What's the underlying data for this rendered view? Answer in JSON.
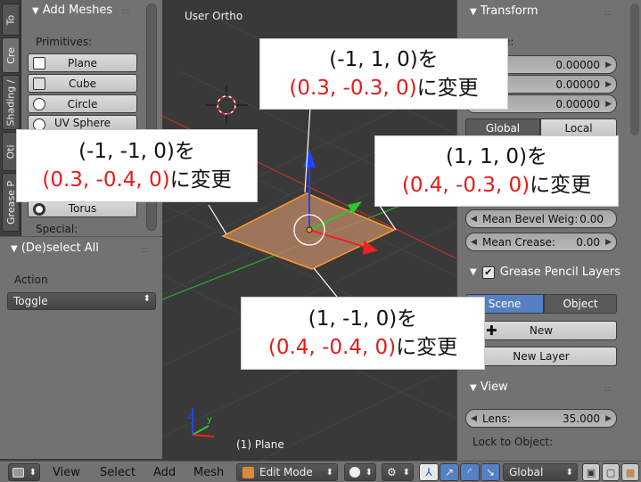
{
  "tabs": [
    "To",
    "Cre",
    "Shading /",
    "Oti",
    "Grease P"
  ],
  "shelf": {
    "title": "Add Meshes",
    "primitives_label": "Primitives:",
    "buttons": [
      "Plane",
      "Cube",
      "Circle",
      "UV Sphere",
      "Torus"
    ],
    "special_label": "Special:"
  },
  "operator": {
    "title": "(De)select All",
    "action_label": "Action",
    "action_value": "Toggle"
  },
  "viewport": {
    "view_label": "User Ortho",
    "object_label": "(1) Plane",
    "colors": {
      "selection": "#ffa033",
      "x_axis": "#e22",
      "y_axis": "#2ec82e",
      "z_axis": "#2244ff"
    }
  },
  "callouts": {
    "top": {
      "line1": "(-1, 1, 0)を",
      "red": "(0.3, -0.3, 0)",
      "suffix": "に変更"
    },
    "left": {
      "line1": "(-1, -1, 0)を",
      "red": "(0.3, -0.4, 0)",
      "suffix": "に変更"
    },
    "right": {
      "line1": "(1, 1, 0)を",
      "red": "(0.4, -0.3, 0)",
      "suffix": "に変更"
    },
    "bottom": {
      "line1": "(1, -1, 0)を",
      "red": "(0.4, -0.4, 0)",
      "suffix": "に変更"
    }
  },
  "props": {
    "transform_title": "Transform",
    "partial_label": "e:",
    "values": [
      "0.00000",
      "0.00000",
      "0.00000"
    ],
    "global_label": "Global",
    "local_label": "Local",
    "mean_bevel_label": "Mean Bevel Weig:",
    "mean_bevel_value": "0.00",
    "mean_crease_label": "Mean Crease:",
    "mean_crease_value": "0.00",
    "grease_title": "Grease Pencil Layers",
    "scene_label": "Scene",
    "object_label": "Object",
    "new_label": "New",
    "new_layer_label": "New Layer",
    "view_title": "View",
    "lens_label": "Lens:",
    "lens_value": "35.000",
    "lock_label": "Lock to Object:"
  },
  "footer": {
    "menus": [
      "View",
      "Select",
      "Add",
      "Mesh"
    ],
    "mode": "Edit Mode",
    "orientation": "Global"
  }
}
